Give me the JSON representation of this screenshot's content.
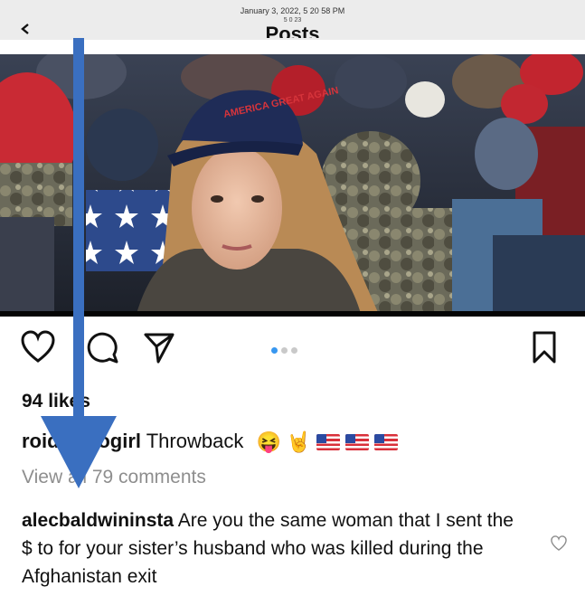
{
  "status": {
    "timestamp": "January 3, 2022, 5 20 58 PM",
    "timestamp_sub": "5 0 23"
  },
  "header": {
    "title": "Posts",
    "back_icon": "chevron-left-icon"
  },
  "photo": {
    "cap_text": "AMERICA GREAT AGAIN"
  },
  "actions": {
    "icons": [
      "heart-icon",
      "comment-icon",
      "share-icon",
      "bookmark-icon"
    ],
    "carousel_dots": 3,
    "active_dot": 1
  },
  "post": {
    "likes": "94 likes",
    "caption_username": "roidowyogirl",
    "caption_text": "Throwback",
    "caption_emoji": [
      "😝",
      "🤘",
      "flag-us",
      "flag-us",
      "flag-us"
    ],
    "view_comments": "View all 79 comments"
  },
  "comment": {
    "username": "alecbaldwininsta",
    "text": "Are you the same woman that I sent the $ to for your sister’s husband who was killed during the Afghanistan exit"
  },
  "colors": {
    "accent_blue": "#3897f0",
    "annotation_arrow": "#3a6fc0",
    "muted_text": "#8e8e8e"
  }
}
